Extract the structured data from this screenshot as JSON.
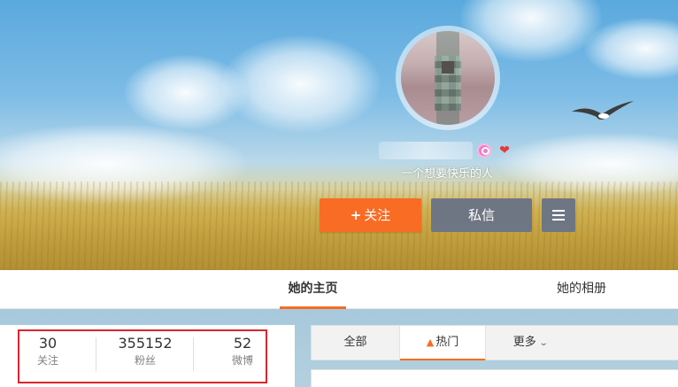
{
  "profile": {
    "bio": "一个想要快乐的人"
  },
  "actions": {
    "follow_plus": "+",
    "follow_label": "关注",
    "message_label": "私信"
  },
  "page_tabs": [
    {
      "label": "她的主页",
      "active": true
    },
    {
      "label": "她的相册",
      "active": false
    }
  ],
  "stats": [
    {
      "value": "30",
      "label": "关注"
    },
    {
      "value": "355152",
      "label": "粉丝"
    },
    {
      "value": "52",
      "label": "微博"
    }
  ],
  "feed_tabs": [
    {
      "label": "全部",
      "active": false
    },
    {
      "label": "热门",
      "active": true,
      "icon": "fire-icon"
    },
    {
      "label": "更多",
      "active": false,
      "icon": "chevron-down-icon"
    }
  ],
  "colors": {
    "accent": "#f86c24",
    "secondary_button": "#6f7683",
    "highlight_outline": "#d9262c"
  }
}
